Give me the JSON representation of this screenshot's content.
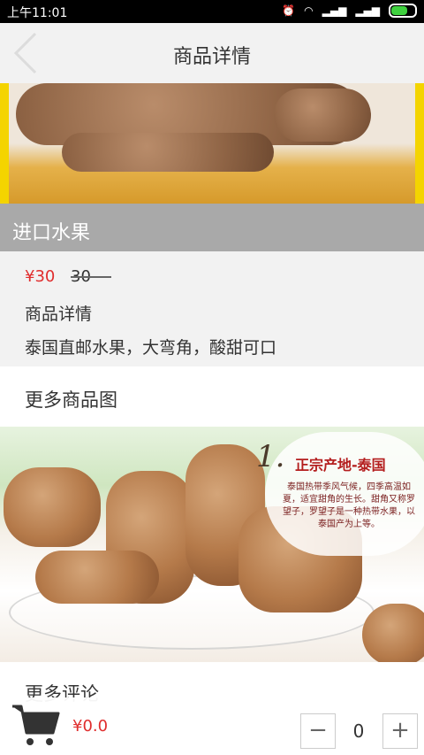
{
  "status": {
    "time": "上午11:01"
  },
  "header": {
    "title": "商品详情"
  },
  "product": {
    "name": "进口水果",
    "price": "¥30",
    "original_price": "30",
    "detail_label": "商品详情",
    "detail_text": "泰国直邮水果，大弯角，酸甜可口"
  },
  "sections": {
    "more_images": "更多商品图",
    "more_reviews": "更多评论"
  },
  "promo_image": {
    "number": "1.",
    "heading": "正宗产地-泰国",
    "body": "泰国热带季风气候，四季高温如夏，适宜甜角的生长。甜角又称罗望子，罗望子是一种热带水果，以泰国产为上等。"
  },
  "cart": {
    "total": "¥0.0",
    "quantity": "0",
    "minus_label": "−",
    "plus_label": "+"
  },
  "icons": [
    "back-icon",
    "cart-icon",
    "alarm-icon",
    "wifi-icon",
    "signal-icon",
    "battery-icon"
  ]
}
